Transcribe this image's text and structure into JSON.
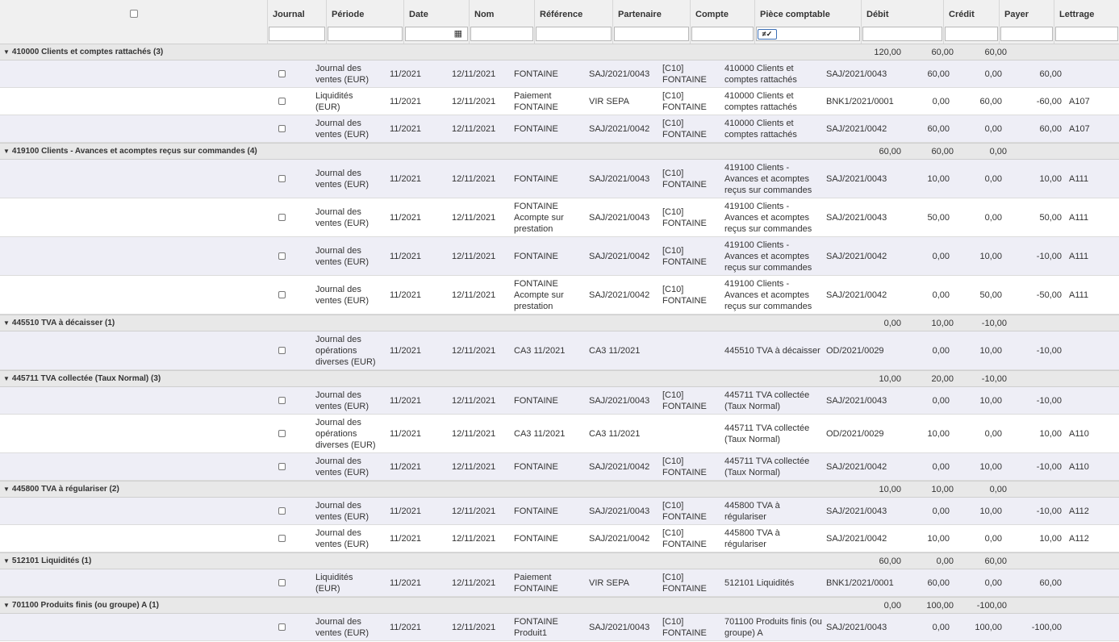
{
  "headers": {
    "journal": "Journal",
    "periode": "Période",
    "date": "Date",
    "nom": "Nom",
    "reference": "Référence",
    "partenaire": "Partenaire",
    "compte": "Compte",
    "piece": "Pièce comptable",
    "debit": "Débit",
    "credit": "Crédit",
    "payer": "Payer",
    "lettrage": "Lettrage",
    "operator": "≠✓"
  },
  "groups": [
    {
      "label": "410000 Clients et comptes rattachés (3)",
      "debit": "120,00",
      "credit": "60,00",
      "solde": "60,00",
      "rows": [
        {
          "journal": "Journal des ventes (EUR)",
          "periode": "11/2021",
          "date": "12/11/2021",
          "nom": "FONTAINE",
          "ref": "SAJ/2021/0043",
          "partenaire": "[C10] FONTAINE",
          "compte": "410000 Clients et comptes rattachés",
          "piece": "SAJ/2021/0043",
          "debit": "60,00",
          "credit": "0,00",
          "payer": "60,00",
          "lettrage": ""
        },
        {
          "journal": "Liquidités (EUR)",
          "periode": "11/2021",
          "date": "12/11/2021",
          "nom": "Paiement FONTAINE",
          "ref": "VIR SEPA",
          "partenaire": "[C10] FONTAINE",
          "compte": "410000 Clients et comptes rattachés",
          "piece": "BNK1/2021/0001",
          "debit": "0,00",
          "credit": "60,00",
          "payer": "-60,00",
          "lettrage": "A107"
        },
        {
          "journal": "Journal des ventes (EUR)",
          "periode": "11/2021",
          "date": "12/11/2021",
          "nom": "FONTAINE",
          "ref": "SAJ/2021/0042",
          "partenaire": "[C10] FONTAINE",
          "compte": "410000 Clients et comptes rattachés",
          "piece": "SAJ/2021/0042",
          "debit": "60,00",
          "credit": "0,00",
          "payer": "60,00",
          "lettrage": "A107"
        }
      ]
    },
    {
      "label": "419100 Clients - Avances et acomptes reçus sur commandes (4)",
      "debit": "60,00",
      "credit": "60,00",
      "solde": "0,00",
      "rows": [
        {
          "journal": "Journal des ventes (EUR)",
          "periode": "11/2021",
          "date": "12/11/2021",
          "nom": "FONTAINE",
          "ref": "SAJ/2021/0043",
          "partenaire": "[C10] FONTAINE",
          "compte": "419100 Clients - Avances et acomptes reçus sur commandes",
          "piece": "SAJ/2021/0043",
          "debit": "10,00",
          "credit": "0,00",
          "payer": "10,00",
          "lettrage": "A111"
        },
        {
          "journal": "Journal des ventes (EUR)",
          "periode": "11/2021",
          "date": "12/11/2021",
          "nom": "FONTAINE Acompte sur prestation",
          "ref": "SAJ/2021/0043",
          "partenaire": "[C10] FONTAINE",
          "compte": "419100 Clients - Avances et acomptes reçus sur commandes",
          "piece": "SAJ/2021/0043",
          "debit": "50,00",
          "credit": "0,00",
          "payer": "50,00",
          "lettrage": "A111"
        },
        {
          "journal": "Journal des ventes (EUR)",
          "periode": "11/2021",
          "date": "12/11/2021",
          "nom": "FONTAINE",
          "ref": "SAJ/2021/0042",
          "partenaire": "[C10] FONTAINE",
          "compte": "419100 Clients - Avances et acomptes reçus sur commandes",
          "piece": "SAJ/2021/0042",
          "debit": "0,00",
          "credit": "10,00",
          "payer": "-10,00",
          "lettrage": "A111"
        },
        {
          "journal": "Journal des ventes (EUR)",
          "periode": "11/2021",
          "date": "12/11/2021",
          "nom": "FONTAINE Acompte sur prestation",
          "ref": "SAJ/2021/0042",
          "partenaire": "[C10] FONTAINE",
          "compte": "419100 Clients - Avances et acomptes reçus sur commandes",
          "piece": "SAJ/2021/0042",
          "debit": "0,00",
          "credit": "50,00",
          "payer": "-50,00",
          "lettrage": "A111"
        }
      ]
    },
    {
      "label": "445510 TVA à décaisser (1)",
      "debit": "0,00",
      "credit": "10,00",
      "solde": "-10,00",
      "rows": [
        {
          "journal": "Journal des opérations diverses (EUR)",
          "periode": "11/2021",
          "date": "12/11/2021",
          "nom": "CA3 11/2021",
          "ref": "CA3 11/2021",
          "partenaire": "",
          "compte": "445510 TVA à décaisser",
          "piece": "OD/2021/0029",
          "debit": "0,00",
          "credit": "10,00",
          "payer": "-10,00",
          "lettrage": ""
        }
      ]
    },
    {
      "label": "445711 TVA collectée (Taux Normal) (3)",
      "debit": "10,00",
      "credit": "20,00",
      "solde": "-10,00",
      "rows": [
        {
          "journal": "Journal des ventes (EUR)",
          "periode": "11/2021",
          "date": "12/11/2021",
          "nom": "FONTAINE",
          "ref": "SAJ/2021/0043",
          "partenaire": "[C10] FONTAINE",
          "compte": "445711 TVA collectée (Taux Normal)",
          "piece": "SAJ/2021/0043",
          "debit": "0,00",
          "credit": "10,00",
          "payer": "-10,00",
          "lettrage": ""
        },
        {
          "journal": "Journal des opérations diverses (EUR)",
          "periode": "11/2021",
          "date": "12/11/2021",
          "nom": "CA3 11/2021",
          "ref": "CA3 11/2021",
          "partenaire": "",
          "compte": "445711 TVA collectée (Taux Normal)",
          "piece": "OD/2021/0029",
          "debit": "10,00",
          "credit": "0,00",
          "payer": "10,00",
          "lettrage": "A110"
        },
        {
          "journal": "Journal des ventes (EUR)",
          "periode": "11/2021",
          "date": "12/11/2021",
          "nom": "FONTAINE",
          "ref": "SAJ/2021/0042",
          "partenaire": "[C10] FONTAINE",
          "compte": "445711 TVA collectée (Taux Normal)",
          "piece": "SAJ/2021/0042",
          "debit": "0,00",
          "credit": "10,00",
          "payer": "-10,00",
          "lettrage": "A110"
        }
      ]
    },
    {
      "label": "445800 TVA à régulariser (2)",
      "debit": "10,00",
      "credit": "10,00",
      "solde": "0,00",
      "rows": [
        {
          "journal": "Journal des ventes (EUR)",
          "periode": "11/2021",
          "date": "12/11/2021",
          "nom": "FONTAINE",
          "ref": "SAJ/2021/0043",
          "partenaire": "[C10] FONTAINE",
          "compte": "445800 TVA à régulariser",
          "piece": "SAJ/2021/0043",
          "debit": "0,00",
          "credit": "10,00",
          "payer": "-10,00",
          "lettrage": "A112"
        },
        {
          "journal": "Journal des ventes (EUR)",
          "periode": "11/2021",
          "date": "12/11/2021",
          "nom": "FONTAINE",
          "ref": "SAJ/2021/0042",
          "partenaire": "[C10] FONTAINE",
          "compte": "445800 TVA à régulariser",
          "piece": "SAJ/2021/0042",
          "debit": "10,00",
          "credit": "0,00",
          "payer": "10,00",
          "lettrage": "A112"
        }
      ]
    },
    {
      "label": "512101 Liquidités (1)",
      "debit": "60,00",
      "credit": "0,00",
      "solde": "60,00",
      "rows": [
        {
          "journal": "Liquidités (EUR)",
          "periode": "11/2021",
          "date": "12/11/2021",
          "nom": "Paiement FONTAINE",
          "ref": "VIR SEPA",
          "partenaire": "[C10] FONTAINE",
          "compte": "512101 Liquidités",
          "piece": "BNK1/2021/0001",
          "debit": "60,00",
          "credit": "0,00",
          "payer": "60,00",
          "lettrage": ""
        }
      ]
    },
    {
      "label": "701100 Produits finis (ou groupe) A (1)",
      "debit": "0,00",
      "credit": "100,00",
      "solde": "-100,00",
      "rows": [
        {
          "journal": "Journal des ventes (EUR)",
          "periode": "11/2021",
          "date": "12/11/2021",
          "nom": "FONTAINE Produit1",
          "ref": "SAJ/2021/0043",
          "partenaire": "[C10] FONTAINE",
          "compte": "701100 Produits finis (ou groupe) A",
          "piece": "SAJ/2021/0043",
          "debit": "0,00",
          "credit": "100,00",
          "payer": "-100,00",
          "lettrage": ""
        }
      ]
    }
  ]
}
